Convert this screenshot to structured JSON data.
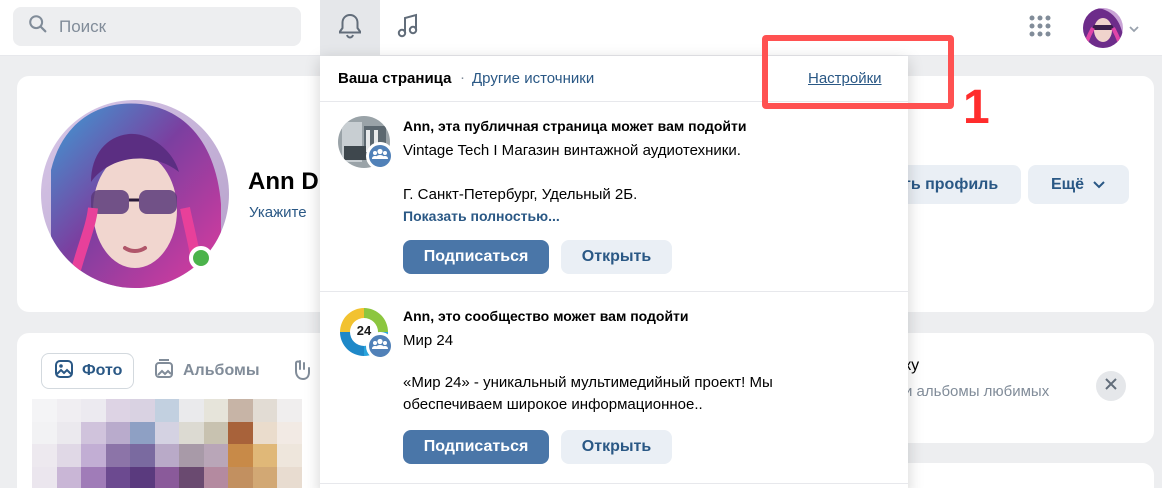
{
  "header": {
    "search_placeholder": "Поиск"
  },
  "profile": {
    "name": "Ann D",
    "status_hint": "Укажите",
    "edit_button": "ть профиль",
    "more_button": "Ещё"
  },
  "photos": {
    "tab_photo": "Фото",
    "tab_albums": "Альбомы"
  },
  "promo": {
    "title": "ку",
    "subtitle": "и альбомы любимых"
  },
  "notifications": {
    "tab_mine": "Ваша страница",
    "separator": "·",
    "tab_other": "Другие источники",
    "settings": "Настройки",
    "items": [
      {
        "title": "Ann, эта публичная страница может вам подойти",
        "name": "Vintage Tech I Магазин винтажной аудиотехники.",
        "description": "Г. Санкт-Петербург, Удельный 2Б.",
        "show_more": "Показать полностью...",
        "subscribe": "Подписаться",
        "open": "Открыть"
      },
      {
        "title": "Ann, это сообщество может вам подойти",
        "name": "Мир 24",
        "description": "«Мир 24» - уникальный мультимедийный проект! Мы обеспечиваем широкое информационное..",
        "subscribe": "Подписаться",
        "open": "Открыть",
        "logo_text": "24"
      }
    ]
  },
  "annotation": {
    "number": "1",
    "color": "#ff5151"
  },
  "colors": {
    "link": "#2a5885",
    "primary_button": "#4a76a8",
    "secondary_button": "#eaeff5",
    "background": "#edeef0",
    "online": "#4bb34b"
  }
}
